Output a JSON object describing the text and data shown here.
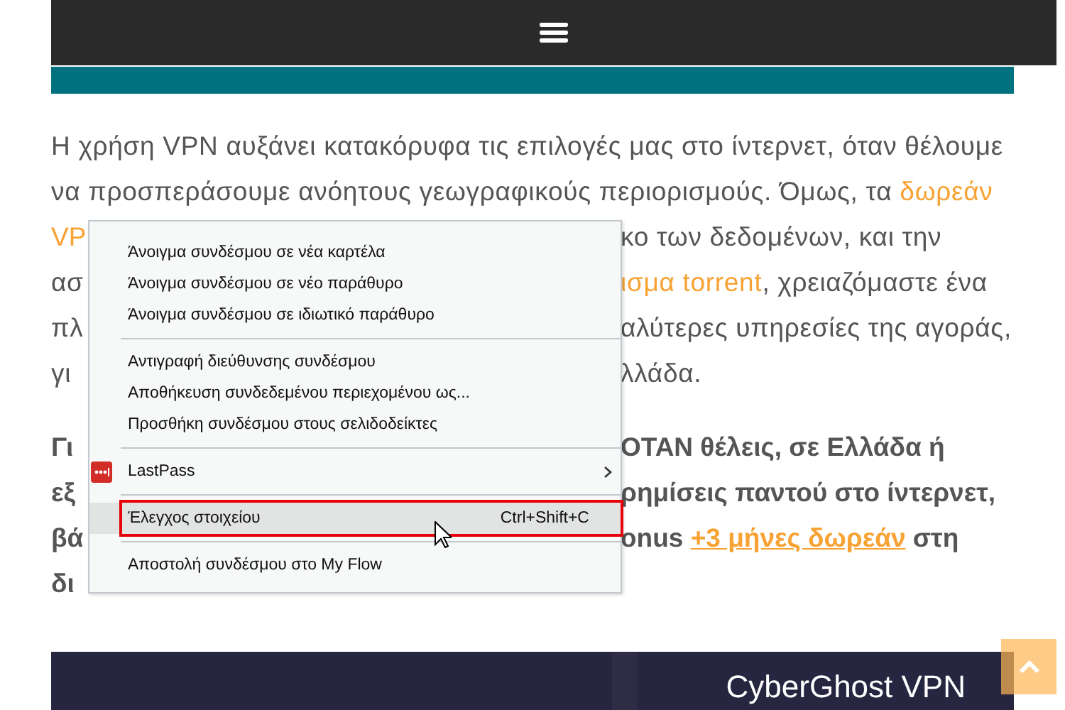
{
  "article": {
    "paragraphs": [
      {
        "bold": false,
        "lines": [
          {
            "left": [
              {
                "text": "Η χρήση VPN αυξάνει κατακόρυφα τις επιλογές μας στο ίντερνετ, όταν θέλουμε",
                "link": false
              }
            ]
          },
          {
            "left": [
              {
                "text": "να προσπεράσουμε ανόητους γεωγραφικούς περιορισμούς. Όμως, τα ",
                "link": false
              },
              {
                "text": "δωρεάν",
                "link": true
              }
            ]
          },
          {
            "left": [
              {
                "text": "VP",
                "link": true
              }
            ],
            "right": [
              {
                "text": "κο των δεδομένων, και την",
                "link": false
              }
            ]
          },
          {
            "left": [
              {
                "text": "ασ",
                "link": false
              }
            ],
            "right": [
              {
                "text": "ισμα torrent",
                "link": true
              },
              {
                "text": ", χρειαζόμαστε ένα",
                "link": false
              }
            ]
          },
          {
            "left": [
              {
                "text": "πλ",
                "link": false
              }
            ],
            "right": [
              {
                "text": "αλύτερες υπηρεσίες της αγοράς,",
                "link": false
              }
            ]
          },
          {
            "left": [
              {
                "text": "γι",
                "link": false
              }
            ],
            "right": [
              {
                "text": "λλάδα.",
                "link": false
              }
            ]
          }
        ]
      },
      {
        "bold": true,
        "lines": [
          {
            "left": [
              {
                "text": "Γι",
                "link": false
              }
            ],
            "right": [
              {
                "text": "ΟΤΑΝ θέλεις, σε Ελλάδα ή",
                "link": false
              }
            ]
          },
          {
            "left": [
              {
                "text": "εξ",
                "link": false
              }
            ],
            "right": [
              {
                "text": "ρημίσεις παντού στο ίντερνετ,",
                "link": false
              }
            ]
          },
          {
            "left": [
              {
                "text": "βά",
                "link": false
              }
            ],
            "right": [
              {
                "text": "onus ",
                "link": false
              },
              {
                "text": "+3 μήνες δωρεάν",
                "link": true
              },
              {
                "text": " στη",
                "link": false
              }
            ]
          },
          {
            "left": [
              {
                "text": "δι",
                "link": false
              }
            ]
          }
        ]
      }
    ]
  },
  "context_menu": {
    "items": [
      {
        "kind": "item",
        "label": "Άνοιγμα συνδέσμου σε νέα καρτέλα",
        "selected": false
      },
      {
        "kind": "item",
        "label": "Άνοιγμα συνδέσμου σε νέο παράθυρο",
        "selected": false
      },
      {
        "kind": "item",
        "label": "Άνοιγμα συνδέσμου σε ιδιωτικό παράθυρο",
        "selected": false
      },
      {
        "kind": "separator"
      },
      {
        "kind": "item",
        "label": "Αντιγραφή διεύθυνσης συνδέσμου",
        "selected": false
      },
      {
        "kind": "item",
        "label": "Αποθήκευση συνδεδεμένου περιεχομένου ως...",
        "selected": false
      },
      {
        "kind": "item",
        "label": "Προσθήκη συνδέσμου στους σελιδοδείκτες",
        "selected": false
      },
      {
        "kind": "separator"
      },
      {
        "kind": "submenu",
        "label": "LastPass",
        "selected": false
      },
      {
        "kind": "separator"
      },
      {
        "kind": "item",
        "label": "Έλεγχος στοιχείου",
        "shortcut": "Ctrl+Shift+C",
        "selected": true,
        "outlined": true
      },
      {
        "kind": "separator"
      },
      {
        "kind": "item",
        "label": "Αποστολή συνδέσμου στο My Flow",
        "selected": false
      }
    ]
  },
  "banner": {
    "title": "CyberGhost VPN"
  }
}
